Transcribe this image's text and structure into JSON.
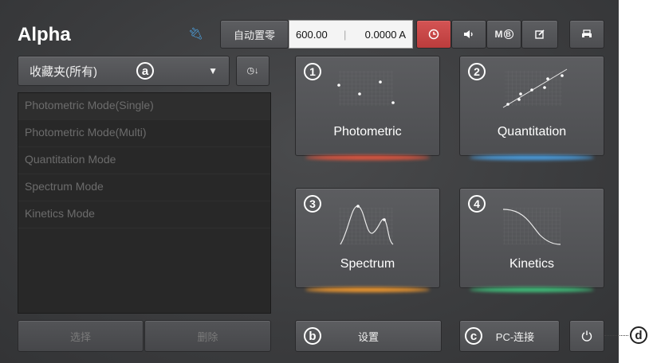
{
  "app": {
    "title": "Alpha"
  },
  "toolbar": {
    "usb_icon": "usb-icon",
    "autozero_label": "自动置零",
    "wavelength": "600.00",
    "absorbance": "0.0000 A",
    "timer_icon": "clock-icon",
    "sound_icon": "speaker-icon",
    "mb_label": "M",
    "edit_icon": "edit-icon",
    "print_icon": "printer-icon",
    "accent_color": "#d04848"
  },
  "favorites": {
    "selected": "收藏夹(所有)",
    "sort_icon": "sort-time-icon",
    "items": [
      "Photometric Mode(Single)",
      "Photometric Mode(Multi)",
      "Quantitation Mode",
      "Spectrum Mode",
      "Kinetics Mode"
    ],
    "select_label": "选择",
    "delete_label": "删除"
  },
  "modes": [
    {
      "num": "1",
      "label": "Photometric",
      "color": "#e2553e"
    },
    {
      "num": "2",
      "label": "Quantitation",
      "color": "#4a9ee0"
    },
    {
      "num": "3",
      "label": "Spectrum",
      "color": "#f0982e"
    },
    {
      "num": "4",
      "label": "Kinetics",
      "color": "#3fbf7a"
    }
  ],
  "bottom": {
    "settings_label": "设置",
    "pc_label": "PC-连接",
    "power_icon": "power-icon"
  },
  "callouts": {
    "a": "a",
    "b": "b",
    "c": "c",
    "d": "d"
  }
}
